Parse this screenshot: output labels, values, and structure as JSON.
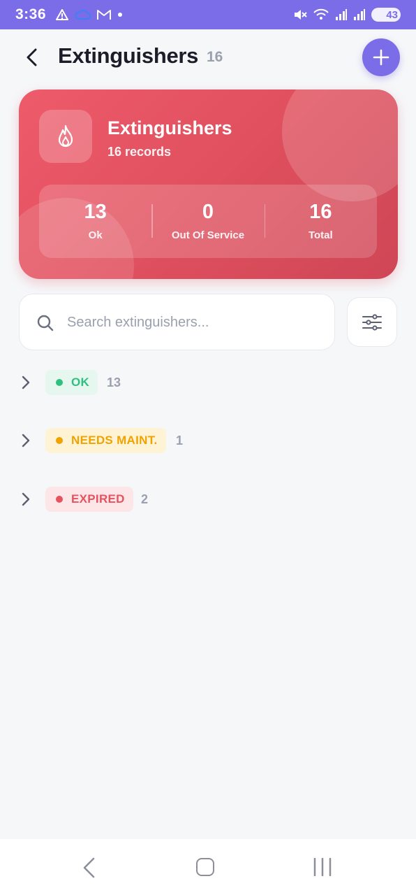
{
  "status_bar": {
    "time": "3:36",
    "battery": "43",
    "icons": [
      "warning-icon",
      "cloud-icon",
      "gmail-icon",
      "dot-icon",
      "mute-icon",
      "wifi-icon",
      "signal-icon",
      "signal-icon"
    ]
  },
  "header": {
    "title": "Extinguishers",
    "count": "16"
  },
  "summary": {
    "title": "Extinguishers",
    "subtitle": "16 records",
    "stats": [
      {
        "value": "13",
        "label": "Ok"
      },
      {
        "value": "0",
        "label": "Out Of Service"
      },
      {
        "value": "16",
        "label": "Total"
      }
    ],
    "accent_color": "#e5535f"
  },
  "search": {
    "placeholder": "Search extinguishers...",
    "value": ""
  },
  "groups": [
    {
      "label": "OK",
      "count": "13",
      "color": "#2fbf7f",
      "bg": "#e6f7ef"
    },
    {
      "label": "NEEDS MAINT.",
      "count": "1",
      "color": "#f0a300",
      "bg": "#fff3d6"
    },
    {
      "label": "EXPIRED",
      "count": "2",
      "color": "#e5535f",
      "bg": "#fde6e8"
    }
  ],
  "theme": {
    "primary": "#7b6ce8",
    "background": "#f6f7f9"
  }
}
